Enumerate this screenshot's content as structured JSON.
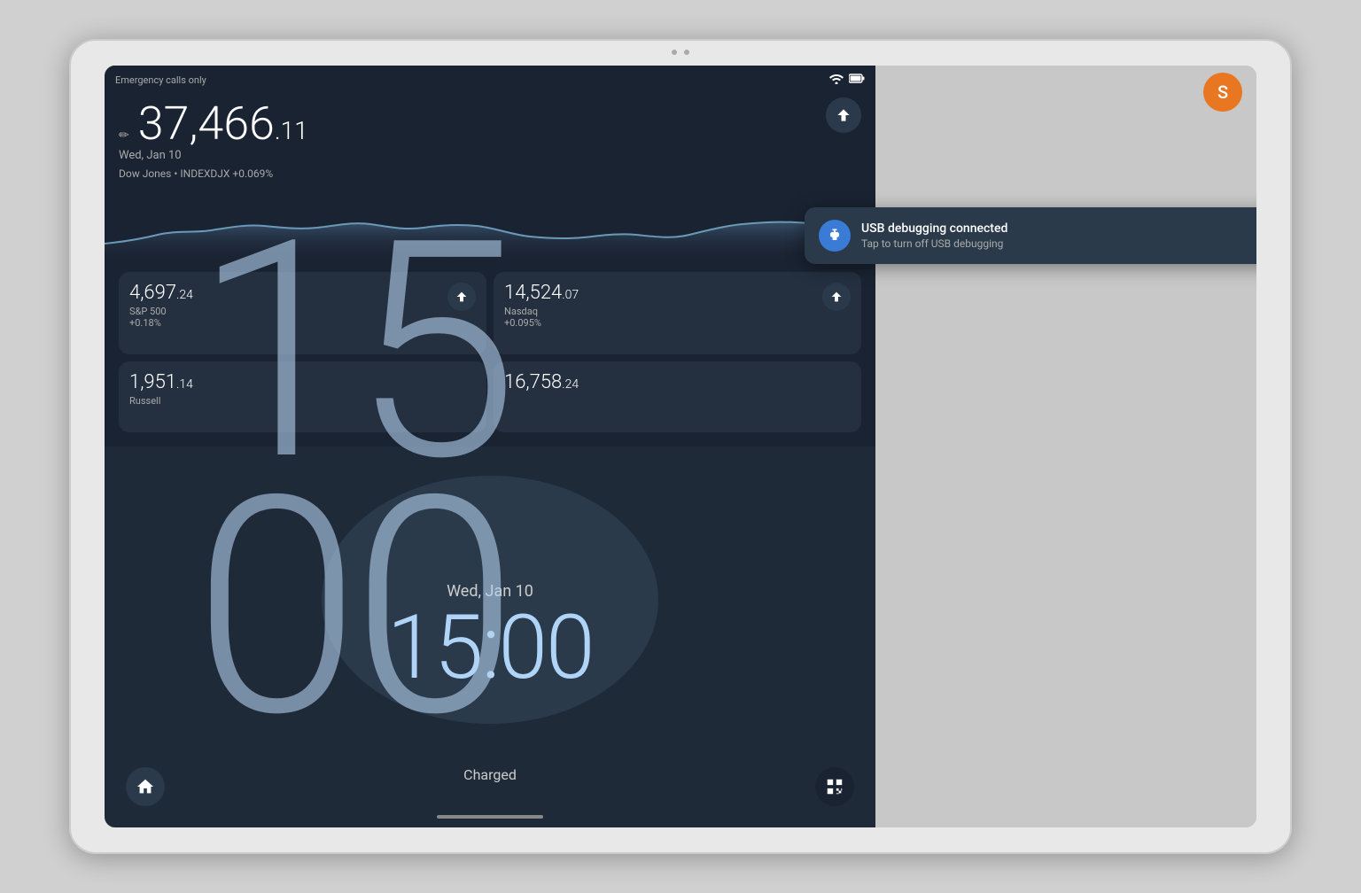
{
  "tablet": {
    "status_bar": {
      "text": "Emergency calls only",
      "wifi_icon": "▲",
      "battery_icon": "▮"
    },
    "stock_widget": {
      "main_value": "37,466",
      "main_decimal": ".11",
      "date": "Wed, Jan 10",
      "index_info": "Dow Jones • INDEXDJX +0.069%",
      "up_button_label": "↑",
      "cards": [
        {
          "value": "4,697",
          "decimal": ".24",
          "name": "S&P 500",
          "change": "+0.18%"
        },
        {
          "value": "14,524",
          "decimal": ".07",
          "name": "Nasdaq",
          "change": "+0.095%"
        },
        {
          "value": "1,951",
          "decimal": ".14",
          "name": "Russell",
          "change": ""
        },
        {
          "value": "16,758",
          "decimal": ".24",
          "name": "",
          "change": ""
        }
      ]
    },
    "clock_widget": {
      "date": "Wed, Jan 10",
      "time": "15:00",
      "charged": "Charged",
      "home_icon": "⌂",
      "qr_icon": "▦"
    },
    "big_clock": {
      "line1": "15",
      "line2": "00"
    },
    "notification": {
      "title": "USB debugging connected",
      "subtitle": "Tap to turn off USB debugging",
      "icon": "USB"
    },
    "user_avatar": {
      "letter": "S",
      "color": "#E97722"
    }
  }
}
